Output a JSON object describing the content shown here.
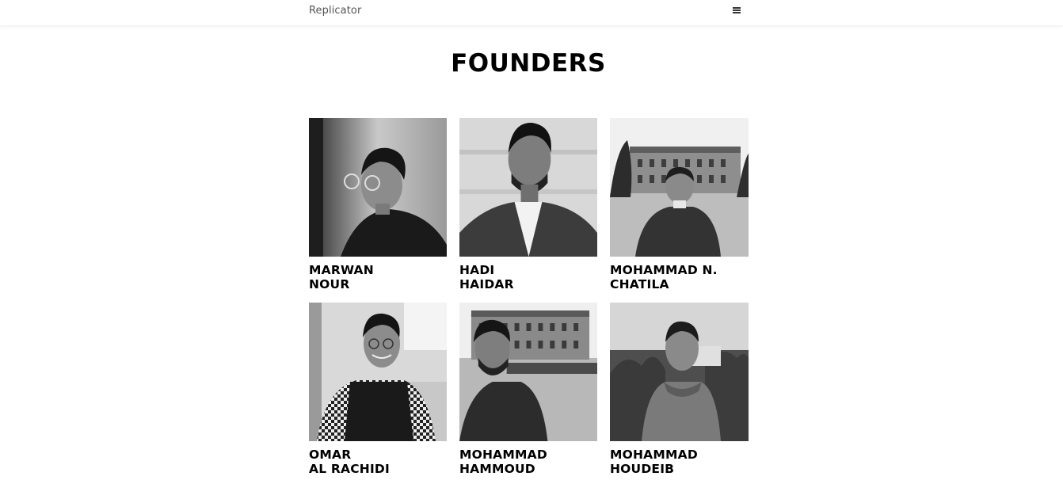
{
  "navbar": {
    "brand": "Replicator",
    "menu_icon": "hamburger-menu-icon"
  },
  "page": {
    "title": "FOUNDERS"
  },
  "founders": [
    {
      "line1": "MARWAN",
      "line2": "NOUR"
    },
    {
      "line1": "HADI",
      "line2": "HAIDAR"
    },
    {
      "line1": "MOHAMMAD N.",
      "line2": "CHATILA"
    },
    {
      "line1": "OMAR",
      "line2": "AL RACHIDI"
    },
    {
      "line1": "MOHAMMAD",
      "line2": "HAMMOUD"
    },
    {
      "line1": "MOHAMMAD",
      "line2": "HOUDEIB"
    }
  ]
}
